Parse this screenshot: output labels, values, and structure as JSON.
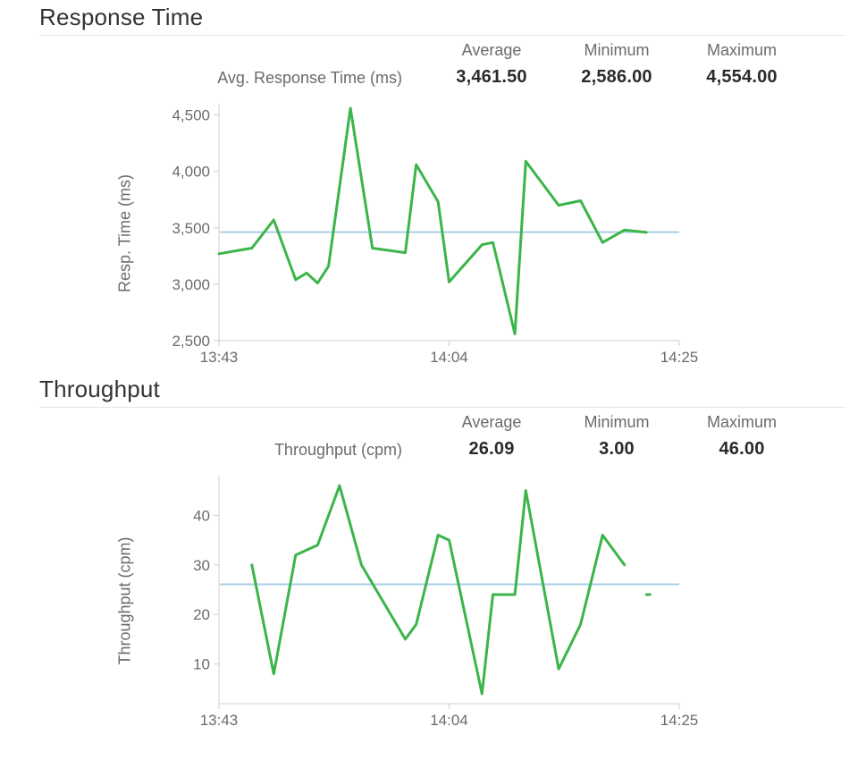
{
  "panels": [
    {
      "id": "response_time",
      "title": "Response Time",
      "stat_headers": [
        "Average",
        "Minimum",
        "Maximum"
      ],
      "stat_name": "Avg. Response Time (ms)",
      "stat_values": [
        "3,461.50",
        "2,586.00",
        "4,554.00"
      ],
      "ylabel": "Resp. Time (ms)"
    },
    {
      "id": "throughput",
      "title": "Throughput",
      "stat_headers": [
        "Average",
        "Minimum",
        "Maximum"
      ],
      "stat_name": "Throughput (cpm)",
      "stat_values": [
        "26.09",
        "3.00",
        "46.00"
      ],
      "ylabel": "Throughput (cpm)"
    }
  ],
  "chart_data": [
    {
      "type": "line",
      "title": "Response Time",
      "ylabel": "Resp. Time (ms)",
      "xlabel": "",
      "x_tick_labels": [
        "13:43",
        "14:04",
        "14:25"
      ],
      "y_ticks": [
        2500,
        3000,
        3500,
        4000,
        4500
      ],
      "y_tick_labels": [
        "2,500",
        "3,000",
        "3,500",
        "4,000",
        "4,500"
      ],
      "ylim": [
        2500,
        4600
      ],
      "xlim_minutes": [
        823,
        865
      ],
      "average": 3461.5,
      "series": [
        {
          "name": "Avg. Response Time (ms)",
          "color": "#3bb54a",
          "x_minutes": [
            823,
            826,
            828,
            830,
            831,
            832,
            833,
            835,
            837,
            840,
            841,
            843,
            844,
            847,
            848,
            850,
            851,
            854,
            856,
            858,
            860,
            862
          ],
          "values": [
            3270,
            3320,
            3570,
            3040,
            3100,
            3010,
            3160,
            4560,
            3320,
            3280,
            4060,
            3730,
            3020,
            3350,
            3370,
            2560,
            4090,
            3700,
            3740,
            3370,
            3480,
            3460
          ]
        }
      ]
    },
    {
      "type": "line",
      "title": "Throughput",
      "ylabel": "Throughput (cpm)",
      "xlabel": "",
      "x_tick_labels": [
        "13:43",
        "14:04",
        "14:25"
      ],
      "y_ticks": [
        10,
        20,
        30,
        40
      ],
      "y_tick_labels": [
        "10",
        "20",
        "30",
        "40"
      ],
      "ylim": [
        2,
        48
      ],
      "xlim_minutes": [
        823,
        865
      ],
      "average": 26.09,
      "series": [
        {
          "name": "Throughput (cpm)",
          "color": "#3bb54a",
          "x_minutes": [
            826,
            828,
            830,
            832,
            834,
            836,
            840,
            841,
            843,
            844,
            847,
            848,
            850,
            851,
            854,
            856,
            858,
            860
          ],
          "values": [
            30,
            8,
            32,
            34,
            46,
            30,
            15,
            18,
            36,
            35,
            4,
            24,
            24,
            45,
            9,
            18,
            36,
            30
          ]
        },
        {
          "name": "tail",
          "color": "#3bb54a",
          "x_minutes": [
            862
          ],
          "values": [
            24
          ]
        }
      ]
    }
  ],
  "colors": {
    "series": "#3bb54a",
    "average_line": "#a8cfe8",
    "axis": "#cfcfcf",
    "text_muted": "#6b6b6b"
  }
}
